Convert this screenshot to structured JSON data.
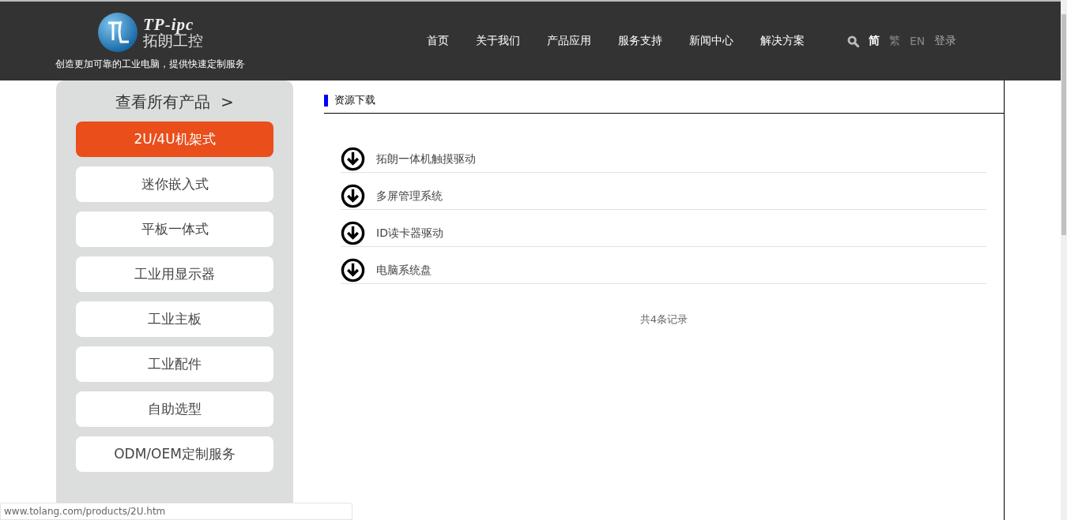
{
  "header": {
    "logo": {
      "latin": "TP-ipc",
      "name": "拓朗工控"
    },
    "slogan": "创造更加可靠的工业电脑，提供快速定制服务",
    "nav": [
      {
        "label": "首页"
      },
      {
        "label": "关于我们"
      },
      {
        "label": "产品应用"
      },
      {
        "label": "服务支持"
      },
      {
        "label": "新闻中心"
      },
      {
        "label": "解决方案"
      }
    ],
    "languages": [
      {
        "label": "简",
        "selected": true
      },
      {
        "label": "繁",
        "selected": false
      },
      {
        "label": "EN",
        "selected": false
      }
    ],
    "login": "登录"
  },
  "sidebar": {
    "title": "查看所有产品",
    "arrow": ">",
    "items": [
      {
        "label": "2U/4U机架式",
        "selected": true
      },
      {
        "label": "迷你嵌入式",
        "selected": false
      },
      {
        "label": "平板一体式",
        "selected": false
      },
      {
        "label": "工业用显示器",
        "selected": false
      },
      {
        "label": "工业主板",
        "selected": false
      },
      {
        "label": "工业配件",
        "selected": false
      },
      {
        "label": "自助选型",
        "selected": false
      },
      {
        "label": "ODM/OEM定制服务",
        "selected": false
      }
    ]
  },
  "content": {
    "section_title": "资源下载",
    "downloads": [
      {
        "label": "拓朗一体机触摸驱动"
      },
      {
        "label": "多屏管理系统"
      },
      {
        "label": "ID读卡器驱动"
      },
      {
        "label": "电脑系统盘"
      }
    ],
    "record_count": "共4条记录"
  },
  "status_bar": {
    "url": "www.tolang.com/products/2U.htm"
  }
}
